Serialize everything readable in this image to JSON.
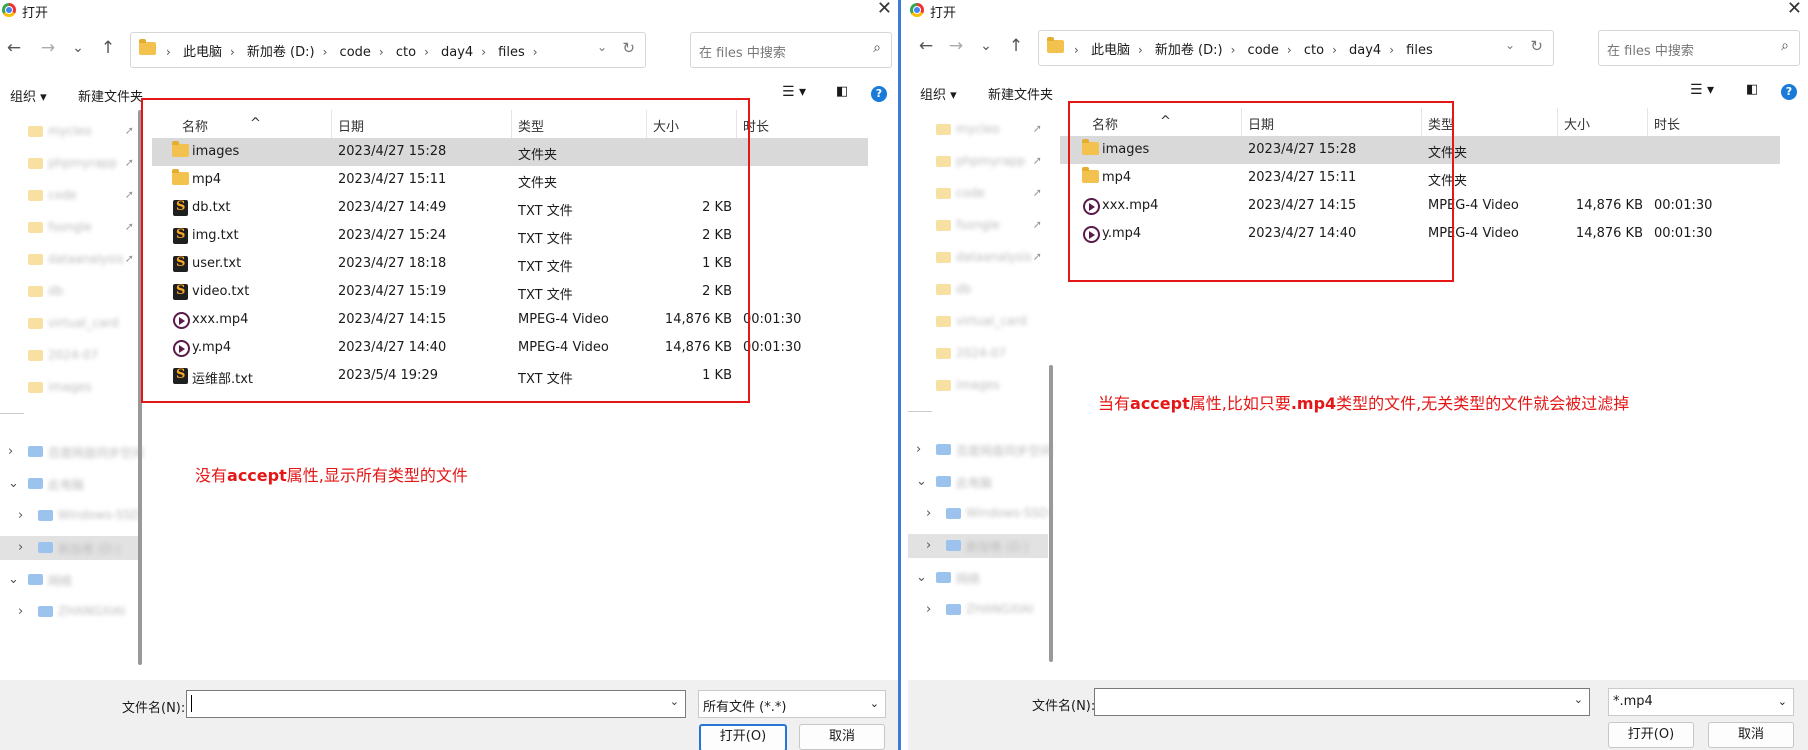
{
  "dialog": {
    "title": "打开",
    "close": "✕",
    "nav": {
      "back": "←",
      "forward": "→",
      "recent": "⌄",
      "up": "↑"
    },
    "breadcrumbs": [
      "此电脑",
      "新加卷 (D:)",
      "code",
      "cto",
      "day4",
      "files"
    ],
    "search_placeholder": "在 files 中搜索",
    "toolbar": {
      "organize": "组织 ▾",
      "new_folder": "新建文件夹",
      "help": "?"
    },
    "columns": {
      "name": "名称",
      "date": "日期",
      "type": "类型",
      "size": "大小",
      "duration": "时长"
    },
    "filename_label": "文件名(N):",
    "filename_value": "",
    "open_button": "打开(O)",
    "cancel_button": "取消"
  },
  "left": {
    "filter": "所有文件 (*.*)",
    "annotation": {
      "pre": "没有",
      "bold": "accept",
      "post": "属性,显示所有类型的文件"
    },
    "files": [
      {
        "name": "images",
        "date": "2023/4/27 15:28",
        "type": "文件夹",
        "size": "",
        "duration": "",
        "icon": "folder-icon"
      },
      {
        "name": "mp4",
        "date": "2023/4/27 15:11",
        "type": "文件夹",
        "size": "",
        "duration": "",
        "icon": "folder-icon"
      },
      {
        "name": "db.txt",
        "date": "2023/4/27 14:49",
        "type": "TXT 文件",
        "size": "2 KB",
        "duration": "",
        "icon": "txt-file-icon"
      },
      {
        "name": "img.txt",
        "date": "2023/4/27 15:24",
        "type": "TXT 文件",
        "size": "2 KB",
        "duration": "",
        "icon": "txt-file-icon"
      },
      {
        "name": "user.txt",
        "date": "2023/4/27 18:18",
        "type": "TXT 文件",
        "size": "1 KB",
        "duration": "",
        "icon": "txt-file-icon"
      },
      {
        "name": "video.txt",
        "date": "2023/4/27 15:19",
        "type": "TXT 文件",
        "size": "2 KB",
        "duration": "",
        "icon": "txt-file-icon"
      },
      {
        "name": "xxx.mp4",
        "date": "2023/4/27 14:15",
        "type": "MPEG-4 Video",
        "size": "14,876 KB",
        "duration": "00:01:30",
        "icon": "video-file-icon"
      },
      {
        "name": "y.mp4",
        "date": "2023/4/27 14:40",
        "type": "MPEG-4 Video",
        "size": "14,876 KB",
        "duration": "00:01:30",
        "icon": "video-file-icon"
      },
      {
        "name": "运维部.txt",
        "date": "2023/5/4 19:29",
        "type": "TXT 文件",
        "size": "1 KB",
        "duration": "",
        "icon": "txt-file-icon"
      }
    ]
  },
  "right": {
    "filter": "*.mp4",
    "annotation": {
      "p1": "当有",
      "b1": "accept",
      "p2": "属性,比如只要",
      "b2": ".mp4",
      "p3": "类型的文件,无关类型的文件就会被过滤掉"
    },
    "files": [
      {
        "name": "images",
        "date": "2023/4/27 15:28",
        "type": "文件夹",
        "size": "",
        "duration": "",
        "icon": "folder-icon"
      },
      {
        "name": "mp4",
        "date": "2023/4/27 15:11",
        "type": "文件夹",
        "size": "",
        "duration": "",
        "icon": "folder-icon"
      },
      {
        "name": "xxx.mp4",
        "date": "2023/4/27 14:15",
        "type": "MPEG-4 Video",
        "size": "14,876 KB",
        "duration": "00:01:30",
        "icon": "video-file-icon"
      },
      {
        "name": "y.mp4",
        "date": "2023/4/27 14:40",
        "type": "MPEG-4 Video",
        "size": "14,876 KB",
        "duration": "00:01:30",
        "icon": "video-file-icon"
      }
    ]
  },
  "sidebar_blurred": [
    "mycleo",
    "phpmyrapp",
    "code",
    "fsongle",
    "dataanalysis",
    "db",
    "virtual_card",
    "2024-07",
    "images",
    "百度网盘同步空间",
    "此电脑",
    "Windows-SSD",
    "新加卷 (D:)",
    "网络",
    "ZHANGXIAI"
  ],
  "colors": {
    "annotation": "#e41616",
    "selection": "#d9d9d9",
    "accent": "#2776d6",
    "divider": "#3d7bd9"
  }
}
